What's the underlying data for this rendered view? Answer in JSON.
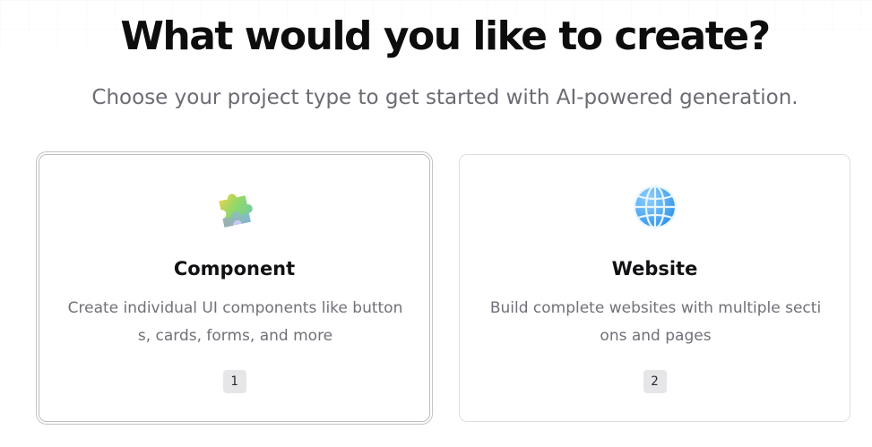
{
  "header": {
    "title": "What would you like to create?",
    "subtitle": "Choose your project type to get started with AI-powered generation."
  },
  "options": [
    {
      "icon": "puzzle-piece-icon",
      "title": "Component",
      "description": "Create individual UI components like buttons, cards, forms, and more",
      "shortcut": "1",
      "selected": true
    },
    {
      "icon": "globe-icon",
      "title": "Website",
      "description": "Build complete websites with multiple sections and pages",
      "shortcut": "2",
      "selected": false
    }
  ],
  "colors": {
    "title": "#0d0d0d",
    "subtitle": "#6b6b73",
    "card_border": "#dedee2",
    "selected_border": "#bdbdc2",
    "badge_bg": "#e6e6e8",
    "description": "#707078"
  }
}
